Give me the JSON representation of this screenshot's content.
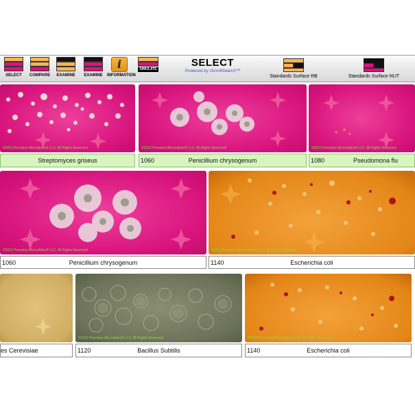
{
  "toolbar": {
    "select_label": "SELECT",
    "compare_label": "COMPARE",
    "examine1_label": "EXAMINE",
    "examine2_label": "EXAMINE",
    "information_label": "INFORMATION",
    "simulate_label": "SIMULATE",
    "info_glyph": "i",
    "title": "SELECT",
    "subtitle": "Powered by iScrollSearch™",
    "std_rb_label": "Standards Surface RB",
    "std_nut_label": "Standards Surface NUT"
  },
  "colors": {
    "pink": "#d8147d",
    "orange": "#e48617",
    "olive_media": "#6e735a",
    "caption_green": "#d8f5c0"
  },
  "copyright": "©2012 Precision Microslides® LLC.  All Rights Reserved",
  "rows": [
    {
      "tiles": [
        {
          "number": "",
          "name": "Streptomyces griseus"
        },
        {
          "number": "1060",
          "name": "Penicillium chrysogenum"
        },
        {
          "number": "1080",
          "name": "Pseudomona flu"
        }
      ]
    },
    {
      "tiles": [
        {
          "number": "1060",
          "name": "Penicillium chrysogenum"
        },
        {
          "number": "1140",
          "name": "Escherichia coli"
        }
      ]
    },
    {
      "tiles": [
        {
          "number": "",
          "name": "es Cerevisiae"
        },
        {
          "number": "1120",
          "name": "Bacillus Subtilis"
        },
        {
          "number": "1140",
          "name": "Escherichia coli"
        }
      ]
    }
  ]
}
